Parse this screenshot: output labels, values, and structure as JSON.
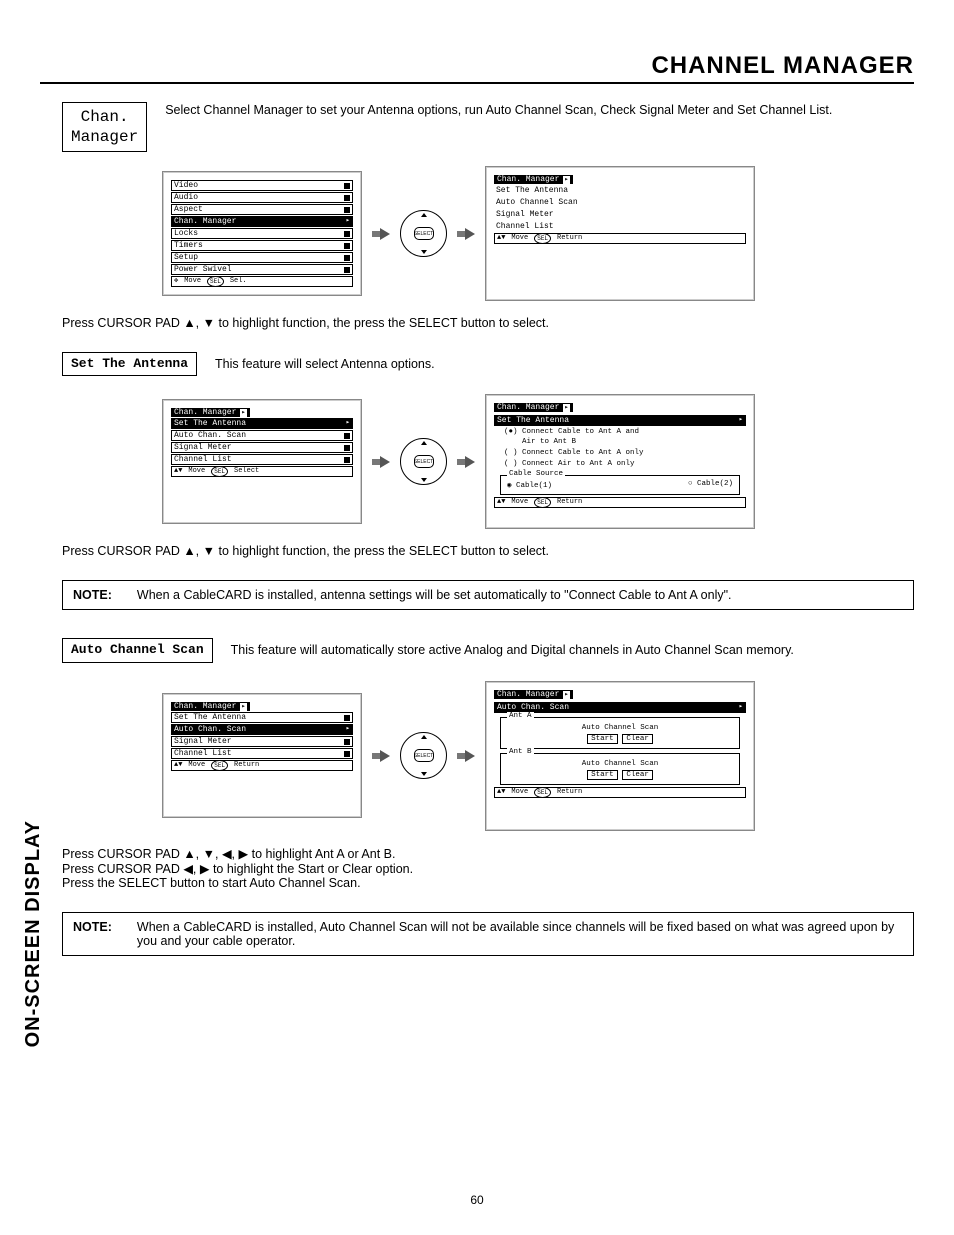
{
  "header": {
    "title": "CHANNEL MANAGER"
  },
  "side_label": "ON-SCREEN DISPLAY",
  "page_number": "60",
  "intro": {
    "box": "Chan.\nManager",
    "text": "Select Channel Manager to set your Antenna options, run Auto Channel Scan, Check Signal Meter and Set Channel List."
  },
  "select_btn_label": "SELECT",
  "instr1": "Press CURSOR PAD ▲, ▼ to highlight function, the press the SELECT button to select.",
  "main_menu": {
    "items": [
      "Video",
      "Audio",
      "Aspect",
      "Chan. Manager",
      "Locks",
      "Timers",
      "Setup",
      "Power Swivel"
    ],
    "selected_index": 3,
    "footer_move": "Move",
    "footer_action": "Sel.",
    "footer_oval": "SEL"
  },
  "chan_menu": {
    "header": "Chan. Manager",
    "items": [
      "Set The Antenna",
      "Auto Channel Scan",
      "Signal Meter",
      "Channel List"
    ],
    "footer_move": "Move",
    "footer_action": "Return",
    "footer_oval": "SEL"
  },
  "set_antenna": {
    "box": "Set The Antenna",
    "desc": "This feature will select Antenna options.",
    "left_menu": {
      "header": "Chan. Manager",
      "items": [
        "Set The Antenna",
        "Auto Chan. Scan",
        "Signal Meter",
        "Channel List"
      ],
      "selected_index": 0,
      "footer_move": "Move",
      "footer_action": "Select",
      "footer_oval": "SEL"
    },
    "detail": {
      "header": "Chan. Manager",
      "sub_header": "Set The Antenna",
      "radio1": "(●) Connect Cable to Ant A and\n    Air to Ant B",
      "radio2": "( ) Connect Cable to Ant A only",
      "radio3": "( ) Connect Air to Ant A only",
      "group_label": "Cable Source",
      "opt1": "◉ Cable(1)",
      "opt2": "○ Cable(2)",
      "footer_move": "Move",
      "footer_action": "Return",
      "footer_oval": "SEL"
    },
    "instr": "Press CURSOR PAD ▲, ▼ to highlight function, the press the SELECT button to select.",
    "note_label": "NOTE:",
    "note_text": "When a CableCARD is installed, antenna settings will be set automatically to \"Connect Cable to Ant A only\"."
  },
  "auto_scan": {
    "box": "Auto Channel Scan",
    "desc": "This feature will automatically store active Analog and Digital channels in Auto Channel Scan memory.",
    "left_menu": {
      "header": "Chan. Manager",
      "items": [
        "Set The Antenna",
        "Auto Chan. Scan",
        "Signal Meter",
        "Channel List"
      ],
      "selected_index": 1,
      "footer_move": "Move",
      "footer_action": "Return",
      "footer_oval": "SEL"
    },
    "detail": {
      "header": "Chan. Manager",
      "sub_header": "Auto Chan. Scan",
      "groupA": "Ant A",
      "groupB": "Ant B",
      "line_label": "Auto Channel Scan",
      "start": "Start",
      "clear": "Clear",
      "footer_move": "Move",
      "footer_action": "Return",
      "footer_oval": "SEL"
    },
    "instr_lines": [
      "Press CURSOR PAD ▲, ▼, ◀, ▶ to highlight Ant A or Ant B.",
      "Press CURSOR PAD ◀, ▶ to highlight the Start or Clear option.",
      "Press the SELECT button to start Auto Channel Scan."
    ],
    "note_label": "NOTE:",
    "note_text": "When a CableCARD is installed, Auto Channel Scan will not be available since channels will be fixed based on what was agreed upon by you and your cable operator."
  }
}
